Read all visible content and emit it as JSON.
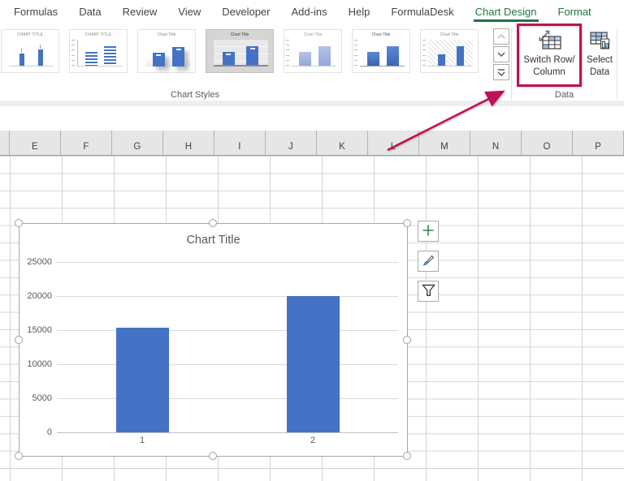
{
  "colors": {
    "accent_green": "#217346",
    "highlight_magenta": "#C01059",
    "bar_blue": "#4472C4",
    "icon_light_blue": "#9DC3E6"
  },
  "tabs": {
    "items": [
      {
        "label": "Formulas",
        "contextual": false,
        "active": false
      },
      {
        "label": "Data",
        "contextual": false,
        "active": false
      },
      {
        "label": "Review",
        "contextual": false,
        "active": false
      },
      {
        "label": "View",
        "contextual": false,
        "active": false
      },
      {
        "label": "Developer",
        "contextual": false,
        "active": false
      },
      {
        "label": "Add-ins",
        "contextual": false,
        "active": false
      },
      {
        "label": "Help",
        "contextual": false,
        "active": false
      },
      {
        "label": "FormulaDesk",
        "contextual": false,
        "active": false
      },
      {
        "label": "Chart Design",
        "contextual": true,
        "active": true
      },
      {
        "label": "Format",
        "contextual": true,
        "active": false
      }
    ]
  },
  "ribbon": {
    "chart_styles_group": {
      "label": "Chart Styles",
      "styles": [
        {
          "name": "style-1",
          "title": "CHART TITLE",
          "selected": false
        },
        {
          "name": "style-2",
          "title": "CHART TITLE",
          "selected": false
        },
        {
          "name": "style-3",
          "title": "Chart Title",
          "selected": false
        },
        {
          "name": "style-4",
          "title": "Chart Title",
          "selected": true
        },
        {
          "name": "style-5",
          "title": "Chart Title",
          "selected": false
        },
        {
          "name": "style-6",
          "title": "Chart Title",
          "selected": false
        },
        {
          "name": "style-7",
          "title": "Chart Title",
          "selected": false
        }
      ],
      "scroll_buttons": [
        {
          "name": "scroll-up",
          "icon": "chevron-up-icon",
          "enabled": false
        },
        {
          "name": "scroll-down",
          "icon": "chevron-down-icon",
          "enabled": true
        },
        {
          "name": "more-styles",
          "icon": "gallery-more-icon",
          "enabled": true
        }
      ]
    },
    "data_group": {
      "label": "Data",
      "switch_button": {
        "line1": "Switch Row/",
        "line2": "Column",
        "icon": "switch-row-column-icon"
      },
      "select_button": {
        "line1": "Select",
        "line2": "Data",
        "icon": "select-data-icon"
      }
    }
  },
  "sheet": {
    "column_headers": [
      "E",
      "F",
      "G",
      "H",
      "I",
      "J",
      "K",
      "L",
      "M",
      "N",
      "O",
      "P"
    ]
  },
  "chart_tools": [
    {
      "name": "chart-elements",
      "icon": "plus-icon"
    },
    {
      "name": "chart-styles",
      "icon": "brush-icon"
    },
    {
      "name": "chart-filters",
      "icon": "funnel-icon"
    }
  ],
  "chart_data": {
    "type": "bar",
    "title": "Chart Title",
    "categories": [
      "1",
      "2"
    ],
    "values": [
      15400,
      20000
    ],
    "xlabel": "",
    "ylabel": "",
    "ylim": [
      0,
      25000
    ],
    "ytick_interval": 5000,
    "bar_color": "#4472C4",
    "grid": true,
    "legend": "none"
  }
}
